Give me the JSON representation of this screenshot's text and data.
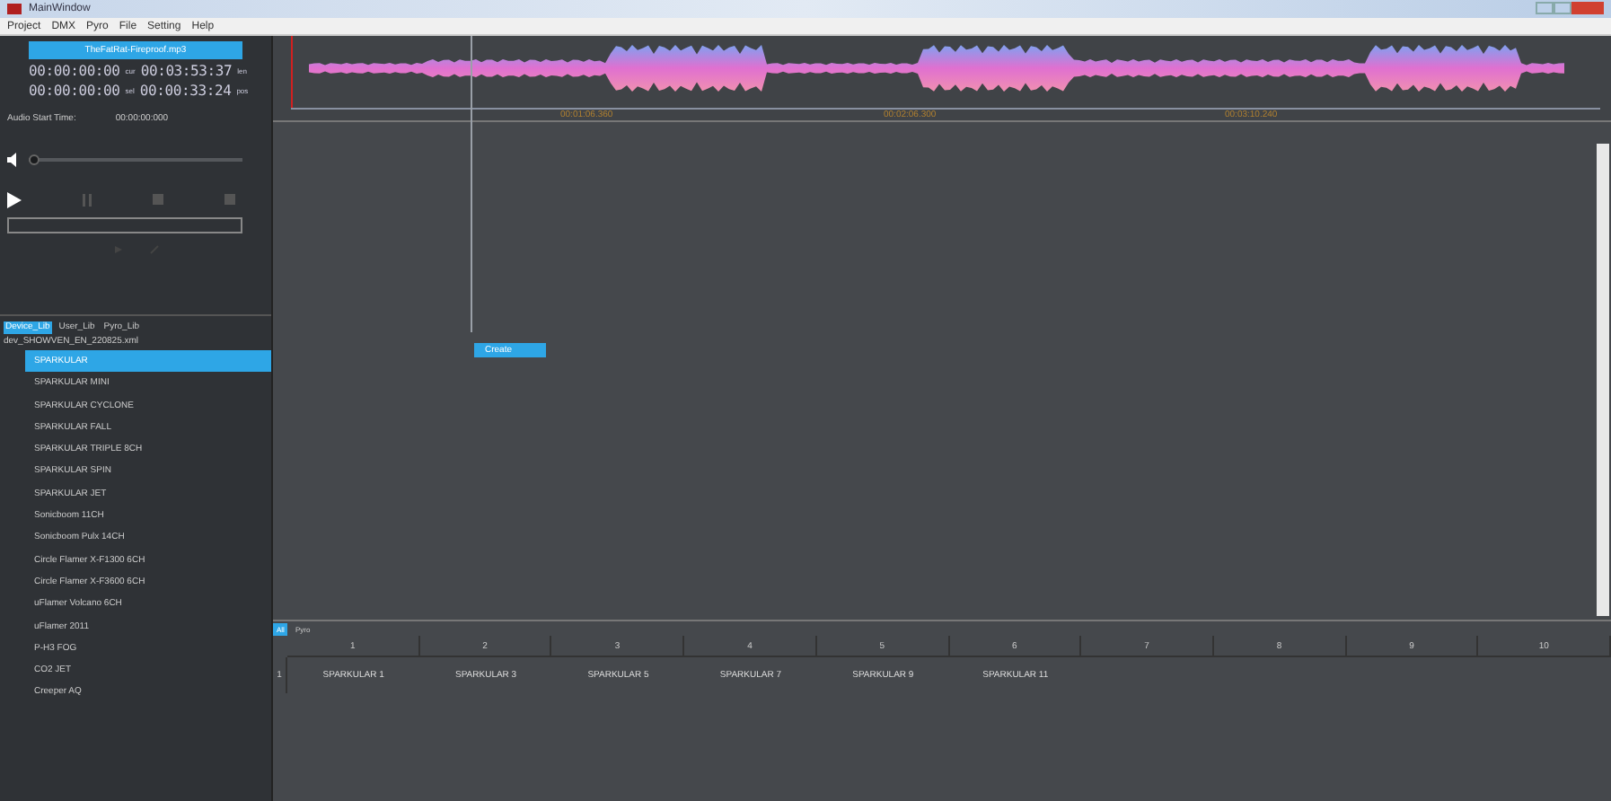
{
  "window": {
    "title": "MainWindow"
  },
  "menu": [
    "Project",
    "DMX",
    "Pyro",
    "File",
    "Setting",
    "Help"
  ],
  "player": {
    "track": "TheFatRat-Fireproof.mp3",
    "timecodes": [
      {
        "left": "00:00:00:00",
        "tag1": "cur",
        "right": "00:03:53:37",
        "tag2": "len"
      },
      {
        "left": "00:00:00:00",
        "tag1": "sel",
        "right": "00:00:33:24",
        "tag2": "pos"
      }
    ],
    "start_label": "Audio Start Time:",
    "start_value": "00:00:00:000",
    "volume": {
      "level": 0.0
    }
  },
  "library_tabs": [
    {
      "label": "Device_Lib",
      "selected": true
    },
    {
      "label": "User_Lib",
      "selected": false
    },
    {
      "label": "Pyro_Lib",
      "selected": false
    }
  ],
  "library_file": "dev_SHOWVEN_EN_220825.xml",
  "devices": [
    {
      "label": "SPARKULAR",
      "selected": true
    },
    {
      "label": "SPARKULAR MINI",
      "selected": false
    },
    {
      "label": "SPARKULAR CYCLONE",
      "selected": false
    },
    {
      "label": "SPARKULAR FALL",
      "selected": false
    },
    {
      "label": "SPARKULAR TRIPLE 8CH",
      "selected": false
    },
    {
      "label": "SPARKULAR SPIN",
      "selected": false
    },
    {
      "label": "SPARKULAR JET",
      "selected": false
    },
    {
      "label": "Sonicboom 11CH",
      "selected": false
    },
    {
      "label": "Sonicboom Pulx 14CH",
      "selected": false
    },
    {
      "label": "Circle Flamer X-F1300 6CH",
      "selected": false
    },
    {
      "label": "Circle Flamer X-F3600 6CH",
      "selected": false
    },
    {
      "label": "uFlamer Volcano 6CH",
      "selected": false
    },
    {
      "label": "uFlamer 2011",
      "selected": false
    },
    {
      "label": "P-H3 FOG",
      "selected": false
    },
    {
      "label": "CO2 JET",
      "selected": false
    },
    {
      "label": "Creeper AQ",
      "selected": false
    }
  ],
  "timeline": {
    "ticks": [
      "00:01:06.360",
      "00:02:06.300",
      "00:03:10.240"
    ],
    "create_button": "Create"
  },
  "bottom_tabs": [
    {
      "label": "All",
      "selected": true
    },
    {
      "label": "Pyro",
      "selected": false
    }
  ],
  "grid": {
    "columns": [
      "1",
      "2",
      "3",
      "4",
      "5",
      "6",
      "7",
      "8",
      "9",
      "10"
    ],
    "rows": [
      {
        "header": "1",
        "cells": [
          "SPARKULAR 1",
          "SPARKULAR 3",
          "SPARKULAR 5",
          "SPARKULAR 7",
          "SPARKULAR 9",
          "SPARKULAR 11"
        ]
      }
    ]
  }
}
